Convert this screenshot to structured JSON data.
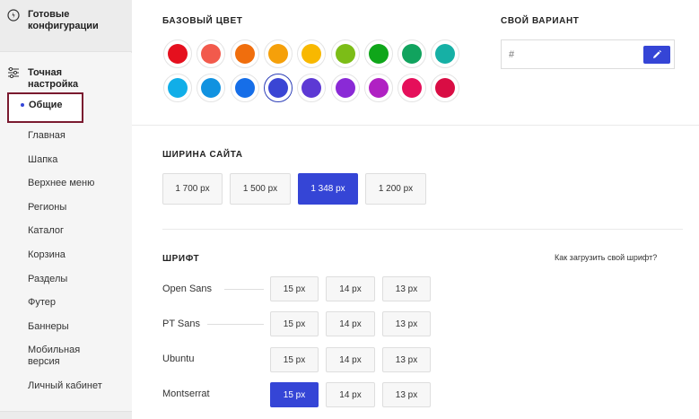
{
  "sidebar": {
    "ready_configs": {
      "label": "Готовые конфигурации",
      "icon": "shield-icon"
    },
    "fine_tuning": {
      "label": "Точная настройка",
      "icon": "sliders-icon"
    },
    "active_item": "Общие",
    "items": [
      {
        "label": "Главная"
      },
      {
        "label": "Шапка"
      },
      {
        "label": "Верхнее меню"
      },
      {
        "label": "Регионы"
      },
      {
        "label": "Каталог"
      },
      {
        "label": "Корзина"
      },
      {
        "label": "Разделы"
      },
      {
        "label": "Футер"
      },
      {
        "label": "Баннеры"
      },
      {
        "label": "Мобильная версия"
      },
      {
        "label": "Личный кабинет"
      }
    ]
  },
  "base_color": {
    "title": "БАЗОВЫЙ ЦВЕТ",
    "selected": "#3a45d4",
    "swatches": [
      "#e5101e",
      "#f25a4c",
      "#f06e0d",
      "#f5a00a",
      "#f8b800",
      "#7cbd17",
      "#0fa61a",
      "#11a35e",
      "#16b0a5",
      "#11aee8",
      "#1192e0",
      "#166ee8",
      "#3a45d4",
      "#5d39d4",
      "#8a2ad6",
      "#b021c3",
      "#e50f5a",
      "#d90d44"
    ]
  },
  "custom_color": {
    "title": "СВОЙ ВАРИАНТ",
    "placeholder": "#",
    "button_icon": "pencil-icon"
  },
  "site_width": {
    "title": "ШИРИНА САЙТА",
    "options": [
      "1 700 px",
      "1 500 px",
      "1 348 px",
      "1 200 px"
    ],
    "selected": "1 348 px"
  },
  "font": {
    "title": "ШРИФТ",
    "help_link": "Как загрузить свой шрифт?",
    "rows": [
      {
        "name": "Open Sans",
        "sizes": [
          "15 px",
          "14 px",
          "13 px"
        ],
        "selected": null
      },
      {
        "name": "PT Sans",
        "sizes": [
          "15 px",
          "14 px",
          "13 px"
        ],
        "selected": null
      },
      {
        "name": "Ubuntu",
        "sizes": [
          "15 px",
          "14 px",
          "13 px"
        ],
        "selected": null
      },
      {
        "name": "Montserrat",
        "sizes": [
          "15 px",
          "14 px",
          "13 px"
        ],
        "selected": "15 px"
      }
    ]
  },
  "colors": {
    "accent": "#3545d6",
    "active_outline": "#7a1a2f"
  }
}
